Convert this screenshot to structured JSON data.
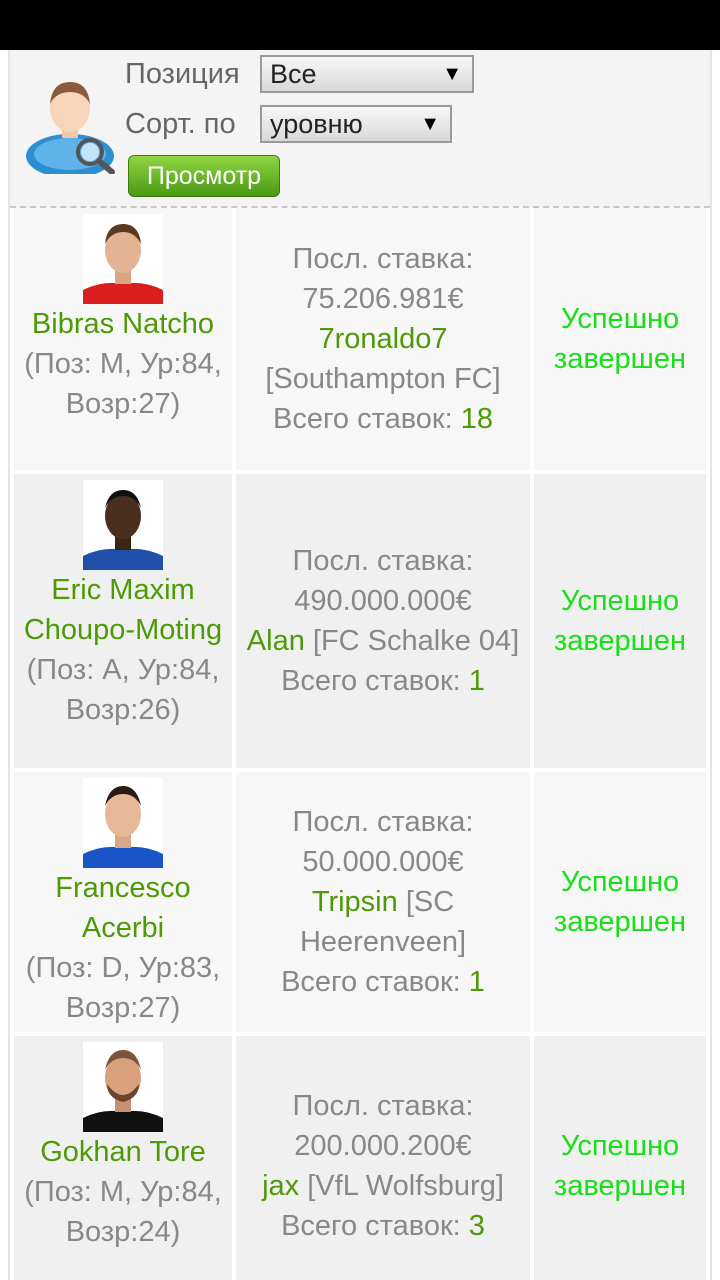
{
  "filter": {
    "position_label": "Позиция",
    "position_value": "Все",
    "sort_label": "Сорт. по",
    "sort_value": "уровню",
    "view_button": "Просмотр"
  },
  "auctions": [
    {
      "name": "Bibras Natcho",
      "info": "(Поз: M, Ур:84, Возр:27)",
      "bid_label": "Посл. ставка:",
      "bid_amount": "75.206.981€",
      "bidder": "7ronaldo7",
      "club": "[Southampton FC]",
      "total_label": "Всего ставок:",
      "total": "18",
      "status": "Успешно завершен"
    },
    {
      "name": "Eric Maxim Choupo-Moting",
      "info": "(Поз: A, Ур:84, Возр:26)",
      "bid_label": "Посл. ставка:",
      "bid_amount": "490.000.000€",
      "bidder": "Alan",
      "club": "[FC Schalke 04]",
      "total_label": "Всего ставок:",
      "total": "1",
      "status": "Успешно завершен"
    },
    {
      "name": "Francesco Acerbi",
      "info": "(Поз: D, Ур:83, Возр:27)",
      "bid_label": "Посл. ставка:",
      "bid_amount": "50.000.000€",
      "bidder": "Tripsin",
      "club": "[SC Heerenveen]",
      "total_label": "Всего ставок:",
      "total": "1",
      "status": "Успешно завершен"
    },
    {
      "name": "Gokhan Tore",
      "info": "(Поз: M, Ур:84, Возр:24)",
      "bid_label": "Посл. ставка:",
      "bid_amount": "200.000.200€",
      "bidder": "jax",
      "club": "[VfL Wolfsburg]",
      "total_label": "Всего ставок:",
      "total": "3",
      "status": "Успешно завершен"
    }
  ],
  "colors": {
    "accent_green": "#4e9a06",
    "status_green": "#18e018",
    "muted_text": "#888888"
  }
}
